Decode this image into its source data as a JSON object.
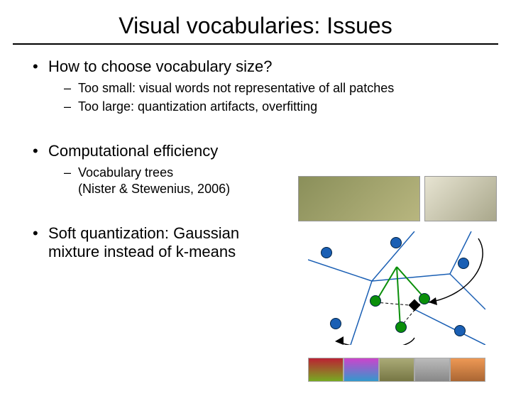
{
  "title": "Visual vocabularies: Issues",
  "bullets": [
    {
      "text": "How to choose vocabulary size?",
      "sub": [
        "Too small: visual words not representative of all patches",
        "Too large: quantization artifacts, overfitting"
      ]
    },
    {
      "text": "Computational efficiency",
      "sub": [
        "Vocabulary trees\n(Nister & Stewenius, 2006)"
      ]
    },
    {
      "text": "Soft quantization: Gaussian mixture instead of k-means",
      "sub": []
    }
  ]
}
